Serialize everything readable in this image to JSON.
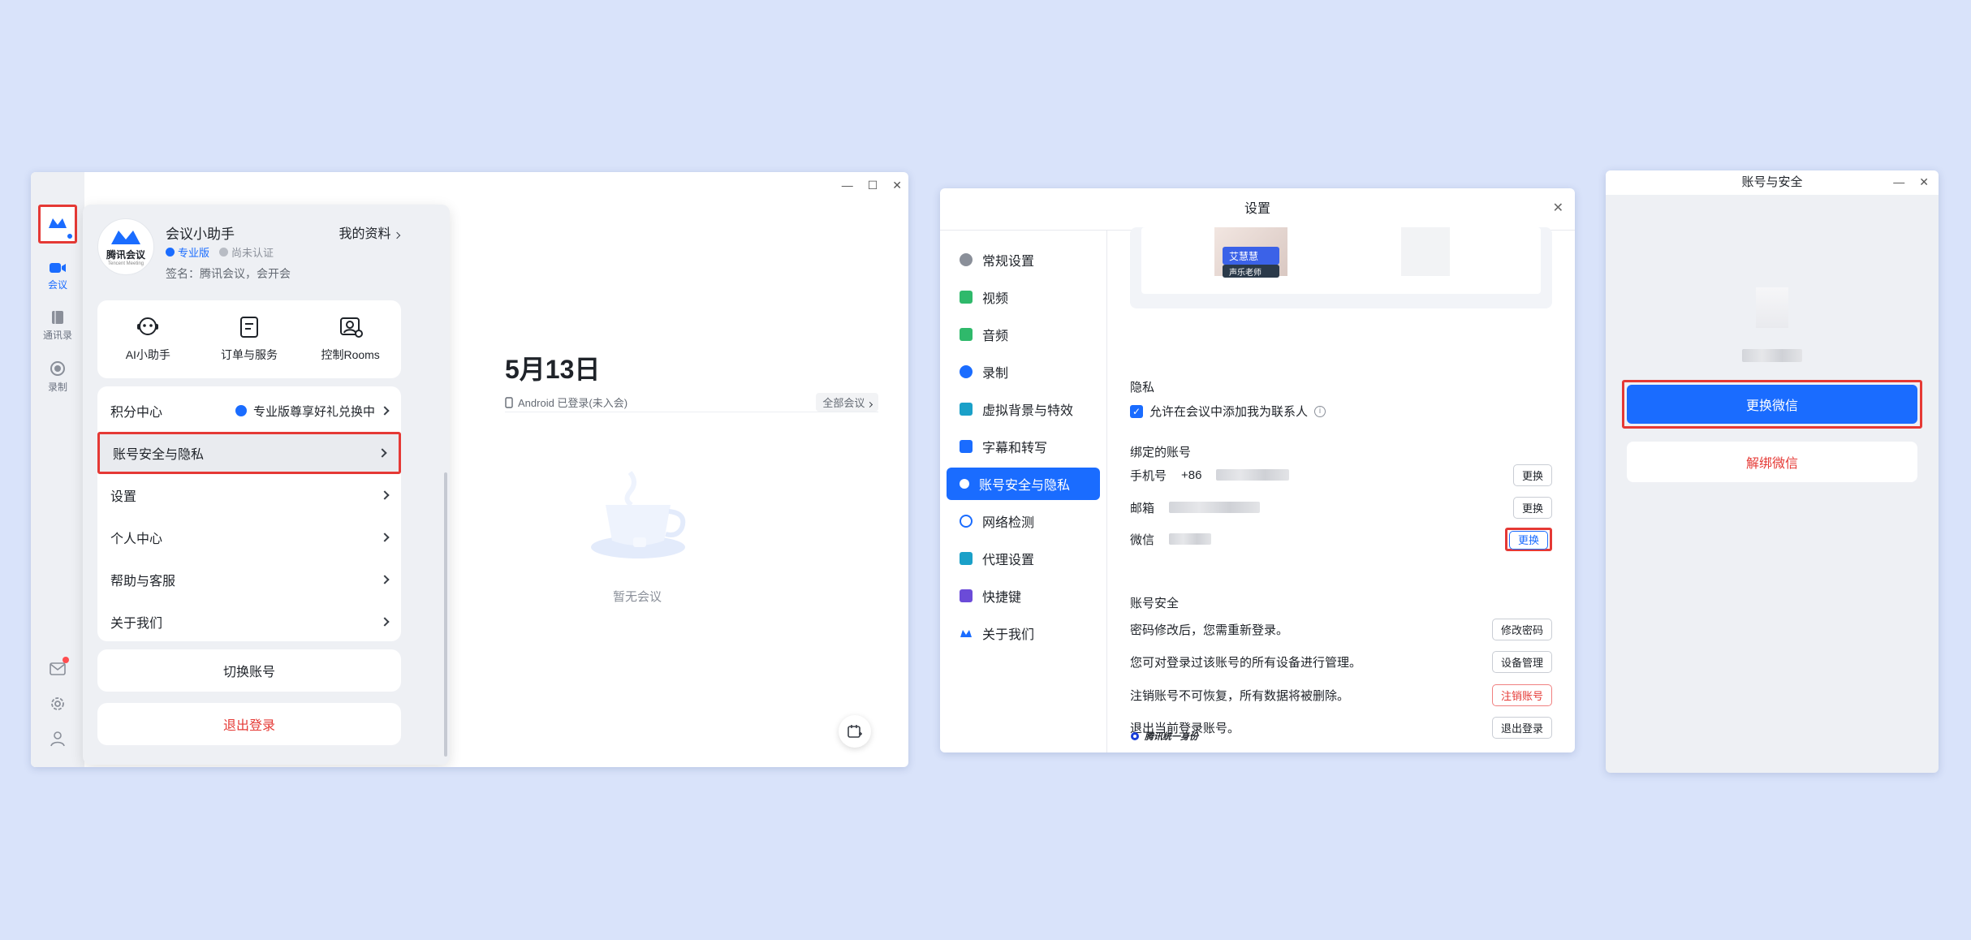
{
  "win1": {
    "sidebar": {
      "nav": [
        {
          "label": "会议",
          "icon": "video-icon"
        },
        {
          "label": "通讯录",
          "icon": "contacts-icon"
        },
        {
          "label": "录制",
          "icon": "record-icon"
        }
      ]
    },
    "profile": {
      "name": "会议小助手",
      "my_profile": "我的资料",
      "pro_tag": "专业版",
      "unverified_tag": "尚未认证",
      "signature": "签名：腾讯会议，会开会",
      "logo_text": "腾讯会议",
      "logo_sub": "Tencent Meeting"
    },
    "quick_actions": [
      {
        "label": "AI小助手",
        "icon": "ai-assistant-icon"
      },
      {
        "label": "订单与服务",
        "icon": "order-icon"
      },
      {
        "label": "控制Rooms",
        "icon": "rooms-control-icon"
      }
    ],
    "menu": [
      {
        "label": "积分中心",
        "extra": "专业版尊享好礼兑换中"
      },
      {
        "label": "账号安全与隐私"
      },
      {
        "label": "设置"
      },
      {
        "label": "个人中心"
      },
      {
        "label": "帮助与客服"
      },
      {
        "label": "关于我们"
      }
    ],
    "switch_account": "切换账号",
    "logout": "退出登录",
    "main": {
      "date": "5月13日",
      "device_status": "Android 已登录(未入会)",
      "all_meetings": "全部会议",
      "empty_text": "暂无会议"
    },
    "colors": {
      "accent": "#1a6cff",
      "highlight": "#e53935"
    }
  },
  "win2": {
    "title": "设置",
    "nav": [
      {
        "label": "常规设置",
        "icon": "gear-icon",
        "color": "#8a8f99"
      },
      {
        "label": "视频",
        "icon": "video-icon",
        "color": "#2fb96b"
      },
      {
        "label": "音频",
        "icon": "speaker-icon",
        "color": "#2fb96b"
      },
      {
        "label": "录制",
        "icon": "record-icon",
        "color": "#1a6cff"
      },
      {
        "label": "虚拟背景与特效",
        "icon": "background-icon",
        "color": "#1aa0c8"
      },
      {
        "label": "字幕和转写",
        "icon": "caption-icon",
        "color": "#1a6cff"
      },
      {
        "label": "账号安全与隐私",
        "icon": "account-security-icon",
        "color": "#ffffff"
      },
      {
        "label": "网络检测",
        "icon": "globe-icon",
        "color": "#1a6cff"
      },
      {
        "label": "代理设置",
        "icon": "proxy-icon",
        "color": "#1aa0c8"
      },
      {
        "label": "快捷键",
        "icon": "keyboard-icon",
        "color": "#6b4bd8"
      },
      {
        "label": "关于我们",
        "icon": "meeting-logo-icon",
        "color": "#1a6cff"
      }
    ],
    "preview_name": "艾慧慧",
    "preview_role": "声乐老师",
    "privacy": {
      "title": "隐私",
      "allow_contact": "允许在会议中添加我为联系人"
    },
    "bound": {
      "title": "绑定的账号",
      "rows": [
        {
          "label": "手机号",
          "prefix": "+86",
          "button": "更换"
        },
        {
          "label": "邮箱",
          "prefix": "",
          "button": "更换"
        },
        {
          "label": "微信",
          "prefix": "",
          "button": "更换"
        }
      ]
    },
    "security": {
      "title": "账号安全",
      "rows": [
        {
          "text": "密码修改后，您需重新登录。",
          "button": "修改密码"
        },
        {
          "text": "您可对登录过该账号的所有设备进行管理。",
          "button": "设备管理"
        },
        {
          "text": "注销账号不可恢复，所有数据将被删除。",
          "button": "注销账号"
        },
        {
          "text": "退出当前登录账号。",
          "button": "退出登录"
        }
      ]
    },
    "footer": "腾讯统一身份"
  },
  "win3": {
    "title": "账号与安全",
    "change_wechat": "更换微信",
    "unbind_wechat": "解绑微信"
  }
}
